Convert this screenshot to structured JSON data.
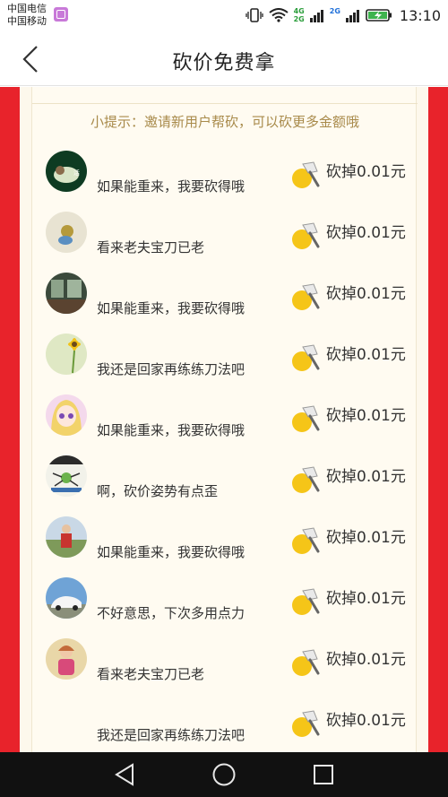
{
  "status_bar": {
    "carrier_1": "中国电信",
    "carrier_2": "中国移动",
    "net_4g": "4G",
    "net_2g": "2G",
    "net_2g_b": "2G",
    "time": "13:10"
  },
  "header": {
    "title": "砍价免费拿"
  },
  "tip": "小提示：邀请新用户帮砍，可以砍更多金额哦",
  "helpers": [
    {
      "message": "如果能重来，我要砍得哦",
      "amount": "砍掉0.01元",
      "avatar": "avatar-green-badge"
    },
    {
      "message": "看来老夫宝刀已老",
      "amount": "砍掉0.01元",
      "avatar": "avatar-figure"
    },
    {
      "message": "如果能重来，我要砍得哦",
      "amount": "砍掉0.01元",
      "avatar": "avatar-room"
    },
    {
      "message": "我还是回家再练练刀法吧",
      "amount": "砍掉0.01元",
      "avatar": "avatar-sunflower"
    },
    {
      "message": "如果能重来，我要砍得哦",
      "amount": "砍掉0.01元",
      "avatar": "avatar-anime"
    },
    {
      "message": "啊，砍价姿势有点歪",
      "amount": "砍掉0.01元",
      "avatar": "avatar-diagram"
    },
    {
      "message": "如果能重来，我要砍得哦",
      "amount": "砍掉0.01元",
      "avatar": "avatar-person-red"
    },
    {
      "message": "不好意思，下次多用点力",
      "amount": "砍掉0.01元",
      "avatar": "avatar-car"
    },
    {
      "message": "看来老夫宝刀已老",
      "amount": "砍掉0.01元",
      "avatar": "avatar-woman"
    },
    {
      "message": "我还是回家再练练刀法吧",
      "amount": "砍掉0.01元",
      "avatar": "none"
    }
  ],
  "icons": {
    "axe": "axe-icon",
    "back": "chevron-left-icon",
    "nav_back": "triangle-back-icon",
    "nav_home": "circle-home-icon",
    "nav_recent": "square-recent-icon"
  },
  "colors": {
    "accent_red": "#e8232b",
    "panel_bg": "#fffbf1",
    "tip_text": "#a88a4a",
    "coin_yellow": "#f5c518"
  }
}
